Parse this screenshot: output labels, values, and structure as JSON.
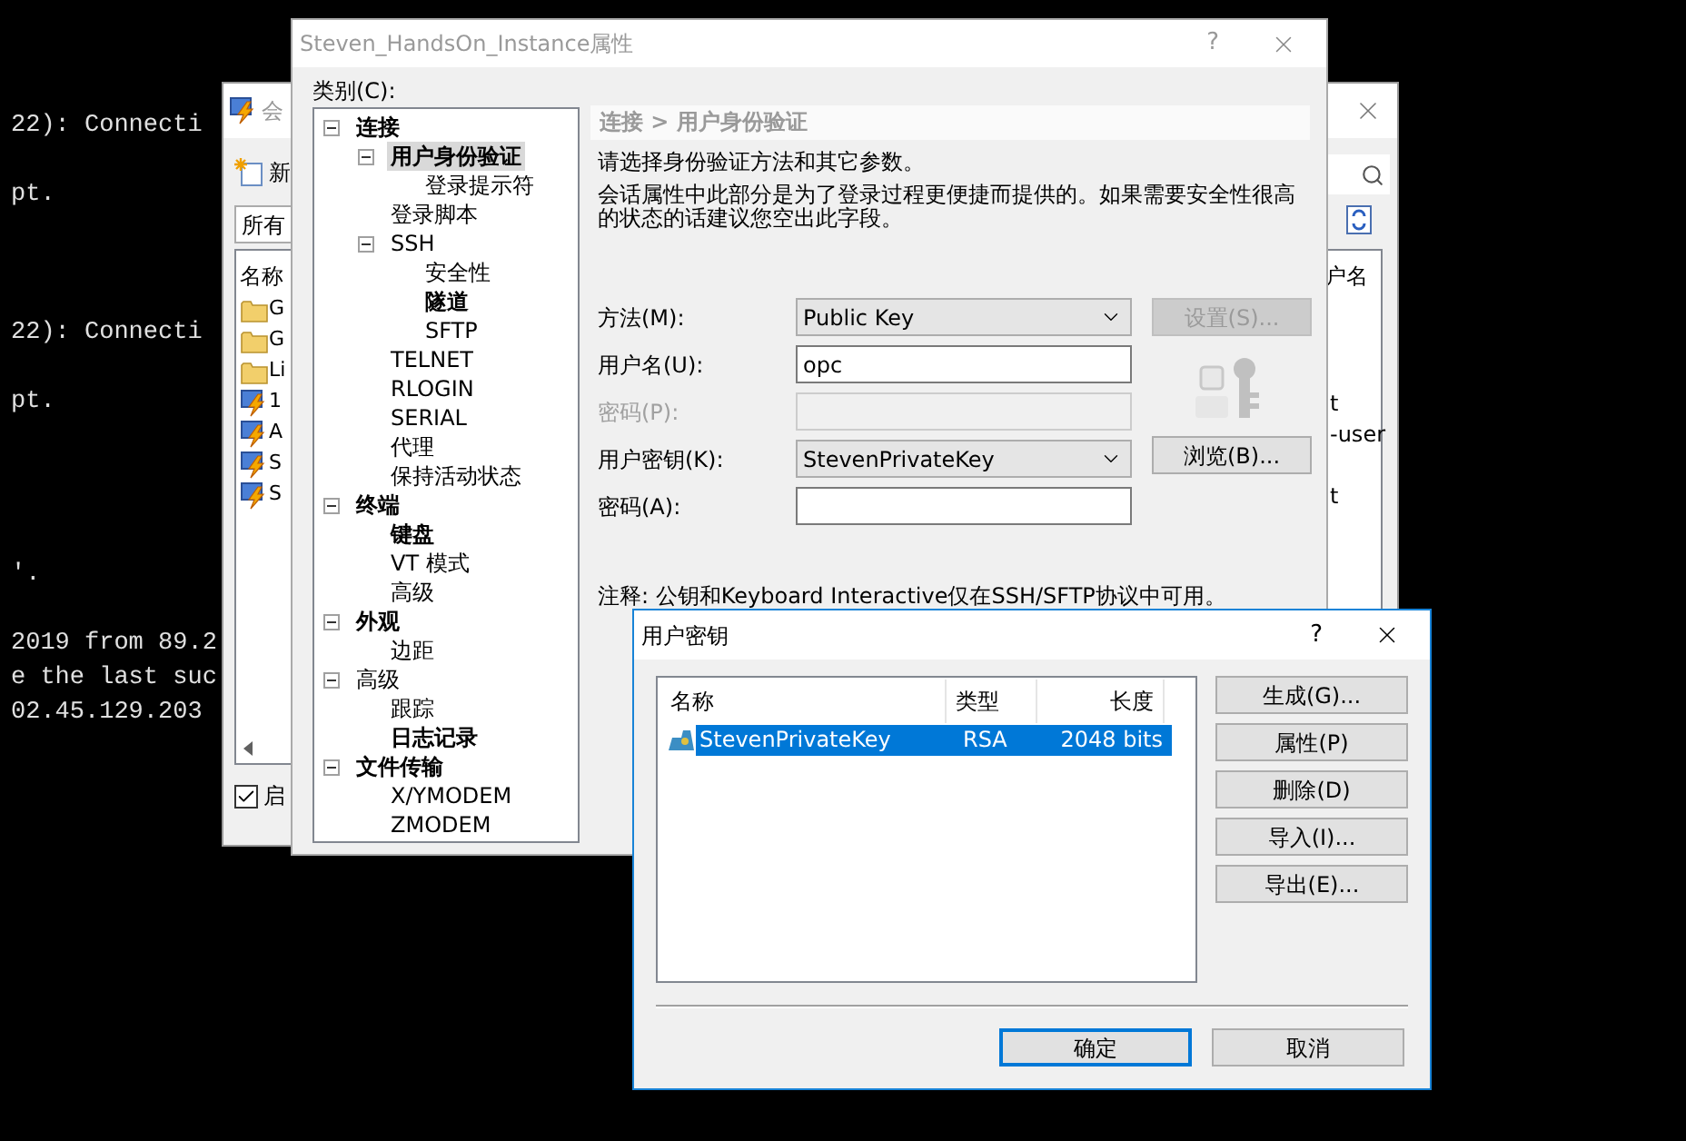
{
  "terminal": {
    "lines": [
      "22): Connecti",
      "pt.",
      "22): Connecti",
      "pt.",
      "'.",
      "2019 from 89.2",
      "e the last suc",
      "02.45.129.203"
    ]
  },
  "session_window": {
    "title": "会",
    "toolbar_label": "新",
    "filter": "所有",
    "list_header": "名称",
    "column_2_header": "户名",
    "items": [
      {
        "kind": "folder",
        "label": "G"
      },
      {
        "kind": "folder",
        "label": "G"
      },
      {
        "kind": "folder",
        "label": "Li"
      },
      {
        "kind": "session",
        "label": "1",
        "column_2": "t"
      },
      {
        "kind": "session",
        "label": "A",
        "column_2": "-user"
      },
      {
        "kind": "session",
        "label": "S"
      },
      {
        "kind": "session",
        "label": "S",
        "column_2": "t"
      }
    ],
    "checkbox": {
      "label": "启",
      "checked": true
    }
  },
  "properties_dialog": {
    "title": "Steven_HandsOn_Instance属性",
    "help": "?",
    "category_label": "类别(C):",
    "tree": [
      {
        "label": "连接",
        "bold": true,
        "selected": false,
        "expanded": true,
        "children": [
          {
            "label": "用户身份验证",
            "bold": true,
            "selected": true,
            "expanded": true,
            "children": [
              {
                "label": "登录提示符",
                "bold": false,
                "selected": false
              }
            ]
          },
          {
            "label": "登录脚本",
            "bold": false,
            "selected": false
          },
          {
            "label": "SSH",
            "bold": false,
            "selected": false,
            "expanded": true,
            "children": [
              {
                "label": "安全性",
                "bold": false,
                "selected": false
              },
              {
                "label": "隧道",
                "bold": true,
                "selected": false
              },
              {
                "label": "SFTP",
                "bold": false,
                "selected": false
              }
            ]
          },
          {
            "label": "TELNET",
            "bold": false,
            "selected": false
          },
          {
            "label": "RLOGIN",
            "bold": false,
            "selected": false
          },
          {
            "label": "SERIAL",
            "bold": false,
            "selected": false
          },
          {
            "label": "代理",
            "bold": false,
            "selected": false
          },
          {
            "label": "保持活动状态",
            "bold": false,
            "selected": false
          }
        ]
      },
      {
        "label": "终端",
        "bold": true,
        "selected": false,
        "expanded": true,
        "children": [
          {
            "label": "键盘",
            "bold": true,
            "selected": false
          },
          {
            "label": "VT 模式",
            "bold": false,
            "selected": false
          },
          {
            "label": "高级",
            "bold": false,
            "selected": false
          }
        ]
      },
      {
        "label": "外观",
        "bold": true,
        "selected": false,
        "expanded": true,
        "children": [
          {
            "label": "边距",
            "bold": false,
            "selected": false
          }
        ]
      },
      {
        "label": "高级",
        "bold": false,
        "selected": false,
        "expanded": true,
        "children": [
          {
            "label": "跟踪",
            "bold": false,
            "selected": false
          },
          {
            "label": "日志记录",
            "bold": true,
            "selected": false
          }
        ]
      },
      {
        "label": "文件传输",
        "bold": true,
        "selected": false,
        "expanded": true,
        "children": [
          {
            "label": "X/YMODEM",
            "bold": false,
            "selected": false
          },
          {
            "label": "ZMODEM",
            "bold": false,
            "selected": false
          }
        ]
      }
    ],
    "breadcrumb": "连接 > 用户身份验证",
    "intro": "请选择身份验证方法和其它参数。",
    "description": "会话属性中此部分是为了登录过程更便捷而提供的。如果需要安全性很高的状态的话建议您空出此字段。",
    "fields": [
      {
        "kind": "dropdown",
        "label": "方法(M):",
        "value": "Public Key",
        "disabled": false,
        "button": {
          "label": "设置(S)...",
          "disabled": true
        }
      },
      {
        "kind": "text",
        "label": "用户名(U):",
        "value": "opc",
        "disabled": false
      },
      {
        "kind": "text",
        "label": "密码(P):",
        "disabled": true
      },
      {
        "kind": "dropdown",
        "label": "用户密钥(K):",
        "value": "StevenPrivateKey",
        "disabled": false,
        "button": {
          "label": "浏览(B)...",
          "disabled": false
        }
      },
      {
        "kind": "text",
        "label": "密码(A):",
        "disabled": false
      }
    ],
    "note": "注释: 公钥和Keyboard Interactive仅在SSH/SFTP协议中可用。"
  },
  "key_dialog": {
    "title": "用户密钥",
    "help": "?",
    "columns": [
      "名称",
      "类型",
      "长度"
    ],
    "rows": [
      {
        "name": "StevenPrivateKey",
        "type": "RSA",
        "length": "2048 bits",
        "selected": true
      }
    ],
    "side_buttons": [
      "生成(G)...",
      "属性(P)",
      "删除(D)",
      "导入(I)...",
      "导出(E)..."
    ],
    "ok": "确定",
    "cancel": "取消"
  }
}
